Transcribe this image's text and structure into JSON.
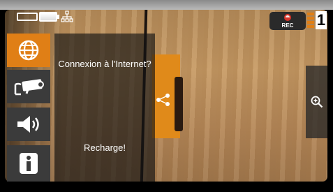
{
  "top_bar": {
    "rec_label": "REC",
    "channel_number": "1"
  },
  "menu": {
    "items": [
      {
        "icon": "globe-icon",
        "active": true
      },
      {
        "icon": "camera-icon",
        "active": false
      },
      {
        "icon": "speaker-icon",
        "active": false
      },
      {
        "icon": "info-icon",
        "active": false
      }
    ]
  },
  "panel": {
    "line1": "Connexion à l'Internet?",
    "line2": "Recharge!"
  },
  "colors": {
    "accent": "#e07f16",
    "menu_inactive": "#3b3b3b",
    "panel_bg": "#141414"
  }
}
